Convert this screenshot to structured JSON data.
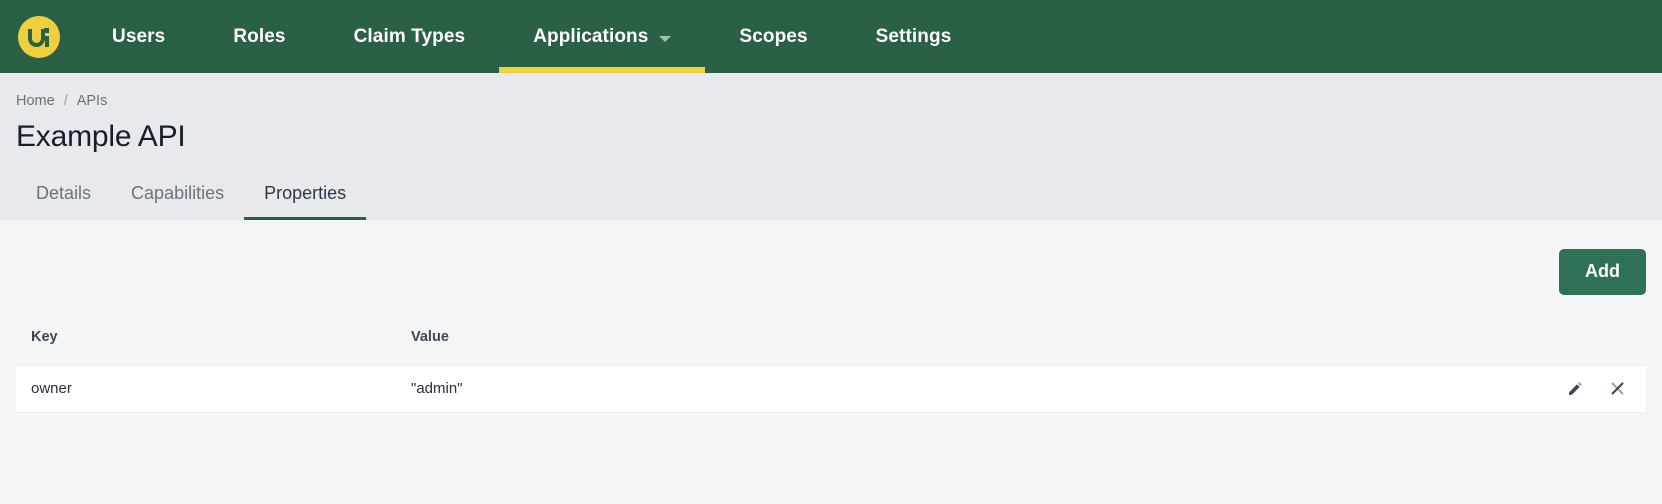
{
  "topnav": {
    "brand": {
      "icon": "ui-logo-icon",
      "color": "#f0cf3e"
    },
    "bg_color": "#2a6146",
    "active_underline_color": "#f0cf3e",
    "items": [
      {
        "label": "Users",
        "active": false,
        "has_caret": false
      },
      {
        "label": "Roles",
        "active": false,
        "has_caret": false
      },
      {
        "label": "Claim Types",
        "active": false,
        "has_caret": false
      },
      {
        "label": "Applications",
        "active": true,
        "has_caret": true
      },
      {
        "label": "Scopes",
        "active": false,
        "has_caret": false
      },
      {
        "label": "Settings",
        "active": false,
        "has_caret": false
      }
    ]
  },
  "header": {
    "breadcrumb": [
      {
        "label": "Home"
      },
      {
        "label": "APIs"
      }
    ],
    "breadcrumb_separator": "/",
    "title": "Example API"
  },
  "tabs": [
    {
      "label": "Details",
      "active": false
    },
    {
      "label": "Capabilities",
      "active": false
    },
    {
      "label": "Properties",
      "active": true
    }
  ],
  "toolbar": {
    "add_label": "Add",
    "add_color": "#2e7154"
  },
  "table": {
    "columns": [
      {
        "key": "key",
        "label": "Key"
      },
      {
        "key": "value",
        "label": "Value"
      }
    ],
    "rows": [
      {
        "key": "owner",
        "value": "\"admin\"",
        "actions": [
          {
            "name": "edit-icon",
            "title": "Edit"
          },
          {
            "name": "delete-icon",
            "title": "Delete"
          }
        ]
      }
    ]
  }
}
